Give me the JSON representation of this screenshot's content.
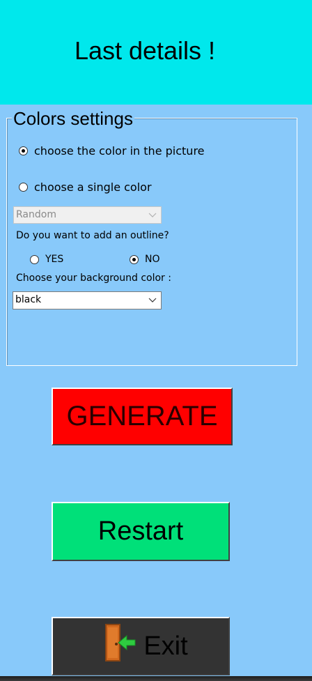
{
  "header": {
    "title": "Last details !"
  },
  "colors_group": {
    "title": "Colors settings",
    "option_picture": "choose the color in the picture",
    "option_single": "choose a single color",
    "single_color_value": "Random",
    "outline_question": "Do you want to add an outline?",
    "outline_yes": "YES",
    "outline_no": "NO",
    "background_label": "Choose your background color :",
    "background_value": "black"
  },
  "buttons": {
    "generate": "GENERATE",
    "restart": "Restart",
    "exit": "Exit"
  },
  "colors": {
    "header_bg": "#00e8ec",
    "window_bg": "#88c9fa",
    "generate_bg": "#ff0000",
    "restart_bg": "#00e079",
    "exit_bg": "#333333"
  },
  "icons": {
    "exit": "door-exit-icon",
    "dropdown": "chevron-down-icon"
  },
  "state": {
    "color_mode": "picture",
    "outline": "NO"
  }
}
